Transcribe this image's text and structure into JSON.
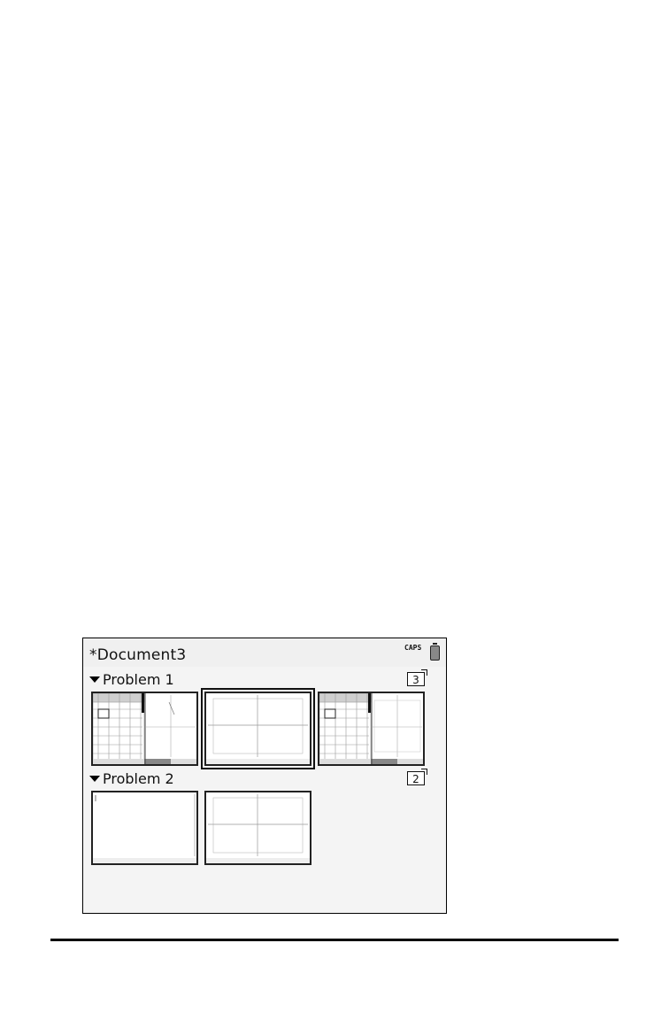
{
  "document": {
    "title": "*Document3"
  },
  "status": {
    "caps": "CAPS",
    "battery_icon": "battery-icon"
  },
  "problems": [
    {
      "label": "Problem 1",
      "page_count": "3"
    },
    {
      "label": "Problem 2",
      "page_count": "2"
    }
  ]
}
